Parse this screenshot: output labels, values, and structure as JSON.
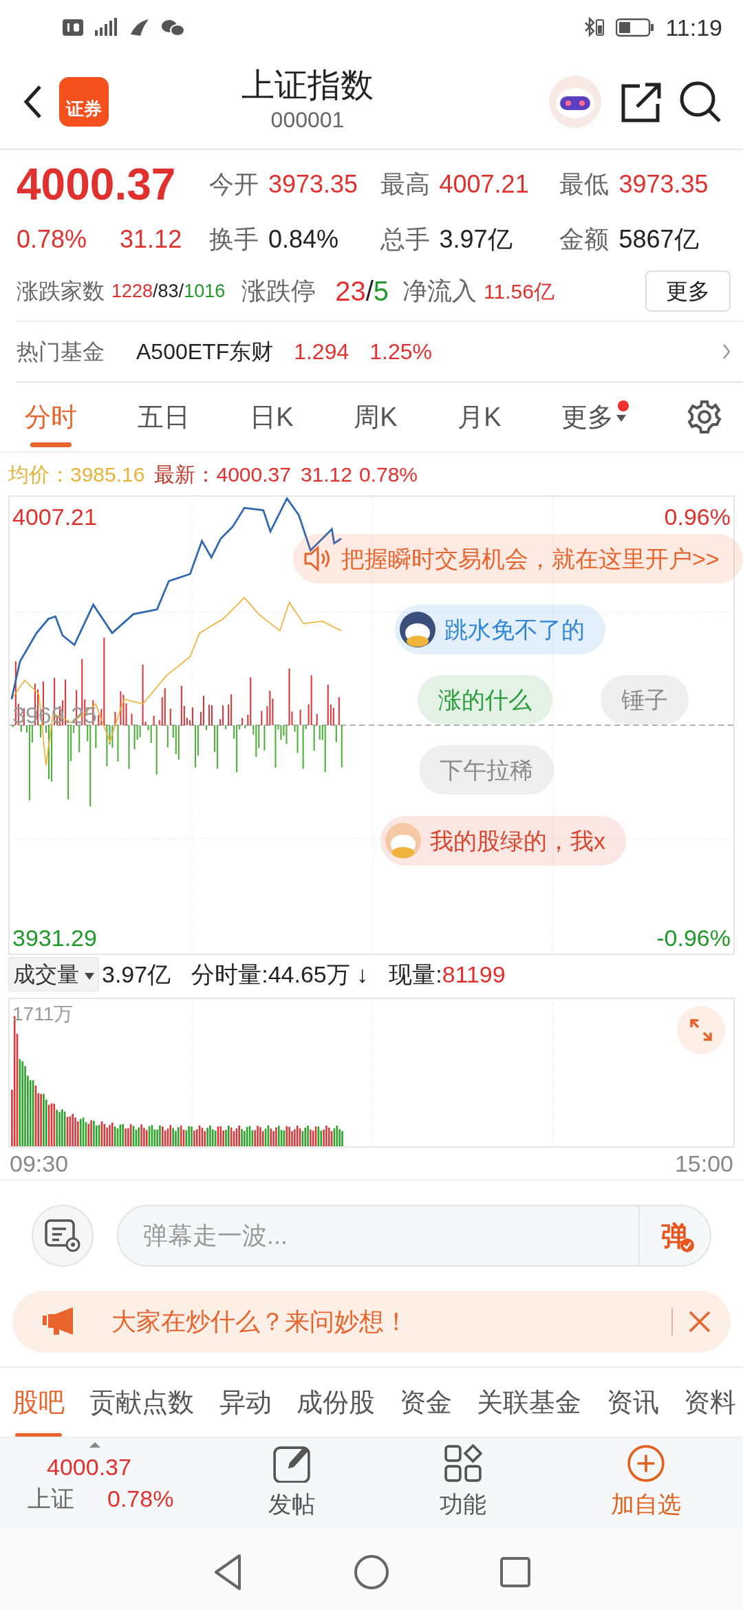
{
  "status_bar": {
    "time": "11:19"
  },
  "header": {
    "logo_text": "证券",
    "title": "上证指数",
    "code": "000001"
  },
  "quote": {
    "price": "4000.37",
    "change_pct": "0.78%",
    "change": "31.12",
    "stats": [
      {
        "label": "今开",
        "value": "3973.35",
        "color": "#e0312f"
      },
      {
        "label": "最高",
        "value": "4007.21",
        "color": "#e0312f"
      },
      {
        "label": "最低",
        "value": "3973.35",
        "color": "#e0312f"
      },
      {
        "label": "换手",
        "value": "0.84%",
        "color": "#222222"
      },
      {
        "label": "总手",
        "value": "3.97亿",
        "color": "#222222"
      },
      {
        "label": "金额",
        "value": "5867亿",
        "color": "#222222"
      }
    ],
    "breadth": {
      "label": "涨跌家数",
      "parts": [
        {
          "text": "1228",
          "color": "#e0312f"
        },
        {
          "text": "/83/",
          "color": "#222222"
        },
        {
          "text": "1016",
          "color": "#1f9a2a"
        }
      ]
    },
    "limits": {
      "label": "涨跌停",
      "parts": [
        {
          "text": "23",
          "color": "#e0312f"
        },
        {
          "text": "/",
          "color": "#222222"
        },
        {
          "text": "5",
          "color": "#1f9a2a"
        }
      ]
    },
    "net_inflow": {
      "label": "净流入",
      "value": "11.56亿"
    },
    "more_button": "更多"
  },
  "hot_fund": {
    "label": "热门基金",
    "name": "A500ETF东财",
    "price": "1.294",
    "change_pct": "1.25%"
  },
  "chart_tabs": [
    {
      "label": "分时",
      "selected": true
    },
    {
      "label": "五日",
      "selected": false
    },
    {
      "label": "日K",
      "selected": false
    },
    {
      "label": "周K",
      "selected": false
    },
    {
      "label": "月K",
      "selected": false
    },
    {
      "label": "更多",
      "selected": false,
      "kind": "menu",
      "notice": true
    }
  ],
  "info_line": [
    {
      "text": "均价：",
      "color": "#e8b23a"
    },
    {
      "text": "3985.16",
      "color": "#e8b23a"
    },
    {
      "text": "最新：",
      "color": "#c0392b"
    },
    {
      "text": "4000.37",
      "color": "#e0312f"
    },
    {
      "text": "31.12",
      "color": "#e0312f"
    },
    {
      "text": "0.78%",
      "color": "#e0312f"
    }
  ],
  "price_chart": {
    "high": "4007.21",
    "low": "3931.29",
    "prev_close": "3969.25",
    "high_pct": "0.96%",
    "low_pct": "-0.96%"
  },
  "danmaku": [
    {
      "text": "把握瞬时交易机会，就在这里开户>>",
      "kind": "ad",
      "color": "#e8642c"
    },
    {
      "text": "跳水免不了的",
      "kind": "avatar",
      "color": "#2f86d6"
    },
    {
      "text": "涨的什么",
      "kind": "plain",
      "color": "#2a9d3a"
    },
    {
      "text": "锤子",
      "kind": "plain",
      "color": "#8a8a8a"
    },
    {
      "text": "下午拉稀",
      "kind": "plain",
      "color": "#8a8a8a"
    },
    {
      "text": "我的股绿的，我x",
      "kind": "avatar",
      "color": "#d8452c"
    }
  ],
  "volume": {
    "selector": "成交量",
    "total": "3.97亿",
    "interval": "分时量:44.65万 ↓",
    "current_label": "现量:",
    "current": "81199",
    "max": "1711万",
    "start_time": "09:30",
    "end_time": "15:00"
  },
  "comment_input": {
    "placeholder": "弹幕走一波...",
    "send_label": "弹"
  },
  "banner": {
    "text": "大家在炒什么？来问妙想！"
  },
  "section_tabs": [
    {
      "label": "股吧",
      "selected": true
    },
    {
      "label": "贡献点数",
      "selected": false
    },
    {
      "label": "异动",
      "selected": false
    },
    {
      "label": "成份股",
      "selected": false
    },
    {
      "label": "资金",
      "selected": false
    },
    {
      "label": "关联基金",
      "selected": false
    },
    {
      "label": "资讯",
      "selected": false
    },
    {
      "label": "资料",
      "selected": false
    }
  ],
  "bottom_bar": {
    "index_value": "4000.37",
    "index_name": "上证",
    "index_pct": "0.78%",
    "actions": [
      {
        "label": "发帖",
        "kind": "post",
        "highlighted": false
      },
      {
        "label": "功能",
        "kind": "apps",
        "highlighted": false
      },
      {
        "label": "加自选",
        "kind": "add",
        "highlighted": true
      }
    ]
  }
}
